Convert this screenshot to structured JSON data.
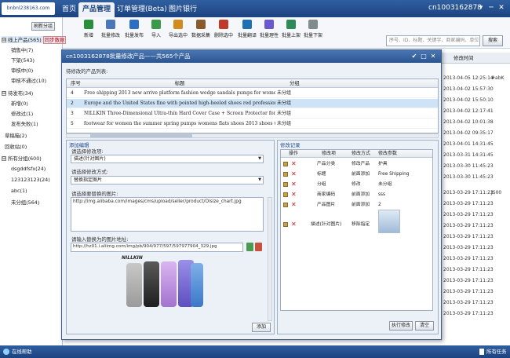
{
  "app": {
    "logo_text": "bnbnl238163.com",
    "nav_tabs": [
      {
        "label": "首页"
      },
      {
        "label": "产品管理"
      },
      {
        "label": "订单管理(Beta)"
      },
      {
        "label": "图片银行"
      }
    ],
    "account": "cn1003162878",
    "window_controls": [
      "▾",
      "─",
      "✕"
    ]
  },
  "toolbar": {
    "buttons": [
      {
        "label": "新增",
        "color": "#2a8f3c"
      },
      {
        "label": "批量修改",
        "color": "#4a78b8"
      },
      {
        "label": "批量发布",
        "color": "#2d6fc4"
      },
      {
        "label": "导入",
        "color": "#3b9a4a"
      },
      {
        "label": "导出选中",
        "color": "#d08a1e"
      },
      {
        "label": "数据采集",
        "color": "#8b5a2b"
      },
      {
        "label": "删除选中",
        "color": "#c0392b"
      },
      {
        "label": "批量翻译",
        "color": "#1f6fb3"
      },
      {
        "label": "批量理性",
        "color": "#6a5acd"
      },
      {
        "label": "批量上架",
        "color": "#2e8b57"
      },
      {
        "label": "批量下架",
        "color": "#7f8c8d"
      }
    ],
    "search_placeholder": "序号、ID、标题、关键字、商家编码、单位",
    "search_button": "搜索"
  },
  "sidebar": {
    "refresh_label": "刷新分组",
    "items": [
      {
        "label": "线上产品",
        "count": "(565)",
        "toggle": "⊟",
        "level": 0,
        "extra": "同步数据"
      },
      {
        "label": "销售中",
        "count": "(7)",
        "level": 1
      },
      {
        "label": "下架",
        "count": "(543)",
        "level": 1
      },
      {
        "label": "审核中",
        "count": "(0)",
        "level": 1
      },
      {
        "label": "审核不通过",
        "count": "(10)",
        "level": 1
      },
      {
        "label": "待发布",
        "count": "(34)",
        "toggle": "⊟",
        "level": 0
      },
      {
        "label": "新增",
        "count": "(0)",
        "level": 1
      },
      {
        "label": "修改过",
        "count": "(1)",
        "level": 1
      },
      {
        "label": "发布失败",
        "count": "(1)",
        "level": 1
      },
      {
        "label": "草稿箱",
        "count": "(2)",
        "level": 0
      },
      {
        "label": "回收站",
        "count": "(0)",
        "level": 0
      },
      {
        "label": "所有分组",
        "count": "(600)",
        "toggle": "⊟",
        "level": 0
      },
      {
        "label": "dsgddfsfx",
        "count": "(24)",
        "level": 1
      },
      {
        "label": "123123123",
        "count": "(24)",
        "level": 1
      },
      {
        "label": "abc",
        "count": "(1)",
        "level": 1
      },
      {
        "label": "未分组",
        "count": "(564)",
        "level": 1
      }
    ]
  },
  "main_grid": {
    "column_header": "修改时间",
    "rows": [
      {
        "time": "2013-04-05 12:25:14",
        "extra": "#abK"
      },
      {
        "time": "2013-04-02 15:57:30",
        "extra": ""
      },
      {
        "time": "2013-04-02 15:50:10",
        "extra": ""
      },
      {
        "time": "2013-04-02 12:17:41",
        "extra": ""
      },
      {
        "time": "2013-04-02 10:01:38",
        "extra": ""
      },
      {
        "time": "2013-04-02 09:35:17",
        "extra": ""
      },
      {
        "time": "2013-04-01 14:31:45",
        "extra": ""
      },
      {
        "time": "2013-03-31 14:31:45",
        "extra": ""
      },
      {
        "time": "2013-03-30 11:45:23",
        "extra": ""
      },
      {
        "time": "2013-03-30 11:45:23",
        "extra": ""
      },
      {
        "time": "2013-03-29 17:11:23",
        "extra": "JS00"
      },
      {
        "time": "2013-03-29 17:11:23",
        "extra": ""
      },
      {
        "time": "2013-03-29 17:11:23",
        "extra": ""
      },
      {
        "time": "2013-03-29 17:11:23",
        "extra": ""
      },
      {
        "time": "2013-03-29 17:11:23",
        "extra": ""
      },
      {
        "time": "2013-03-29 17:11:23",
        "extra": ""
      },
      {
        "time": "2013-03-29 17:11:23",
        "extra": ""
      },
      {
        "time": "2013-03-29 17:11:23",
        "extra": ""
      },
      {
        "time": "2013-03-29 17:11:23",
        "extra": ""
      },
      {
        "time": "2013-03-29 17:11:23",
        "extra": ""
      },
      {
        "time": "2013-03-29 17:11:23",
        "extra": ""
      },
      {
        "time": "2013-03-29 17:11:23",
        "extra": ""
      }
    ]
  },
  "dialog": {
    "title": "cn1003162878批量修改产品——共565个产品",
    "controls": [
      "✔",
      "□",
      "✕"
    ],
    "list_label": "待修改的产品列表:",
    "columns": {
      "num": "序号",
      "title": "标题",
      "group": "分组"
    },
    "products": [
      {
        "num": "4",
        "title": "Free shipping 2013 new arrive platform fashion wedge sandals pumps for women, sexy",
        "group": "未分组"
      },
      {
        "num": "2",
        "title": "Europe and the United States fine with pointed high-heeled shoes red professional",
        "group": "未分组",
        "selected": true
      },
      {
        "num": "3",
        "title": "NILLKIN Three-Dimensional Ultra-thin Hard Cover Case + Screen Protector for iPhone",
        "group": "未分组"
      },
      {
        "num": "5",
        "title": "footwear for women the summer spring pumps womens flats shoes 2013  shoes woman s",
        "group": "未分组"
      }
    ],
    "add_section_label": "添加编辑",
    "field_select_label": "请选择修改项:",
    "field_select_value": "描述(针对图片)",
    "mode_label": "请选择修改方式:",
    "mode_value": "替换指定图片",
    "replace_label": "请选择要替换的图片:",
    "replace_value": "http://img.alibaba.com/images/cms/upload/seller/product/Olsize_chart.jpg",
    "new_url_label": "请输入替换为的图片地址:",
    "new_url_value": "http://hz01.i.aliimg.com/img/pb/904/977/597/597977904_329.jpg",
    "preview_brand": "NILLKIN",
    "add_button": "添加",
    "history_label": "修改记录",
    "history_columns": {
      "op": "操作",
      "item": "修改项",
      "mode": "修改方式",
      "param": "修改参数"
    },
    "history": [
      {
        "item": "产品分类",
        "mode": "修改产品",
        "param": "护具"
      },
      {
        "item": "标题",
        "mode": "前面添加",
        "param": "Free Shipping"
      },
      {
        "item": "分组",
        "mode": "修改",
        "param": "未分组"
      },
      {
        "item": "商家编码",
        "mode": "前面添加",
        "param": "sss"
      },
      {
        "item": "产品图片",
        "mode": "前面添加",
        "param": "2"
      },
      {
        "item": "描述(针对图片)",
        "mode": "移除指定",
        "param": ""
      }
    ],
    "execute_button": "执行修改",
    "clear_button": "清空"
  },
  "statusbar": {
    "left": "在线帮助",
    "right": "所有任务"
  }
}
